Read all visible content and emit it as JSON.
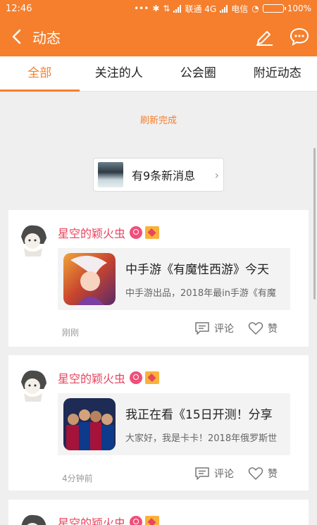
{
  "status_bar": {
    "time": "12:46",
    "carrier1": "联通 4G",
    "carrier2": "电信",
    "battery": "100%"
  },
  "app_bar": {
    "title": "动态",
    "back_icon": "back-arrow-icon",
    "edit_icon": "pen-icon",
    "message_icon": "chat-bubble-icon"
  },
  "tabs": [
    {
      "label": "全部",
      "active": true
    },
    {
      "label": "关注的人",
      "active": false
    },
    {
      "label": "公会圈",
      "active": false
    },
    {
      "label": "附近动态",
      "active": false
    }
  ],
  "refresh_text": "刷新完成",
  "new_messages": {
    "label": "有9条新消息"
  },
  "posts": [
    {
      "author": "星空的颖火虫",
      "share_title": "中手游《有魔性西游》今天",
      "share_desc": "中手游出品，2018年最in手游《有魔",
      "time": "刚刚",
      "comment_label": "评论",
      "like_label": "赞"
    },
    {
      "author": "星空的颖火虫",
      "share_title": "我正在看《15日开测！分享",
      "share_desc": "大家好，我是卡卡！2018年俄罗斯世",
      "time": "4分钟前",
      "comment_label": "评论",
      "like_label": "赞"
    },
    {
      "author": "星空的颖火虫"
    }
  ],
  "colors": {
    "accent": "#f57f2d",
    "name": "#e8455e"
  }
}
